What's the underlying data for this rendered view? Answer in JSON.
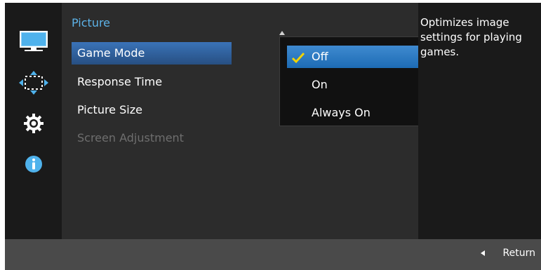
{
  "menu": {
    "title": "Picture",
    "items": [
      {
        "label": "Game Mode"
      },
      {
        "label": "Response Time"
      },
      {
        "label": "Picture Size"
      },
      {
        "label": "Screen Adjustment"
      }
    ]
  },
  "popup": {
    "options": [
      {
        "label": "Off"
      },
      {
        "label": "On"
      },
      {
        "label": "Always On"
      }
    ]
  },
  "description": "Optimizes image settings for playing games.",
  "footer": {
    "return_label": "Return"
  },
  "left_rail": {
    "icons": [
      "picture-icon",
      "screen-adjust-icon",
      "gear-icon",
      "info-icon"
    ]
  },
  "colors": {
    "accent_title": "#5db3e8",
    "selected_item": "#3a73b8",
    "popup_selected": "#2f7ec4",
    "check": "#f2d300"
  }
}
